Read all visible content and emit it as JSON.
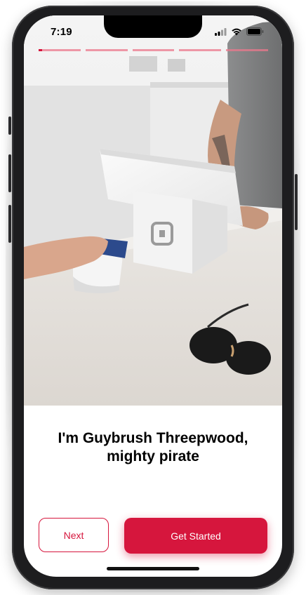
{
  "status_bar": {
    "time": "7:19",
    "icons": [
      "cellular-signal-icon",
      "wifi-icon",
      "battery-icon"
    ]
  },
  "stories": {
    "segments": 5,
    "active_index": 0,
    "active_progress": 0.08,
    "track_color": "#eb788c",
    "fill_color": "#d6163d"
  },
  "hero_image": {
    "subject": "card payment terminal on counter"
  },
  "caption": {
    "line1": "I'm Guybrush Threepwood,",
    "line2": "mighty pirate"
  },
  "buttons": {
    "next_label": "Next",
    "get_started_label": "Get Started"
  },
  "colors": {
    "accent": "#d6163d",
    "background": "#ffffff",
    "text": "#000000"
  }
}
